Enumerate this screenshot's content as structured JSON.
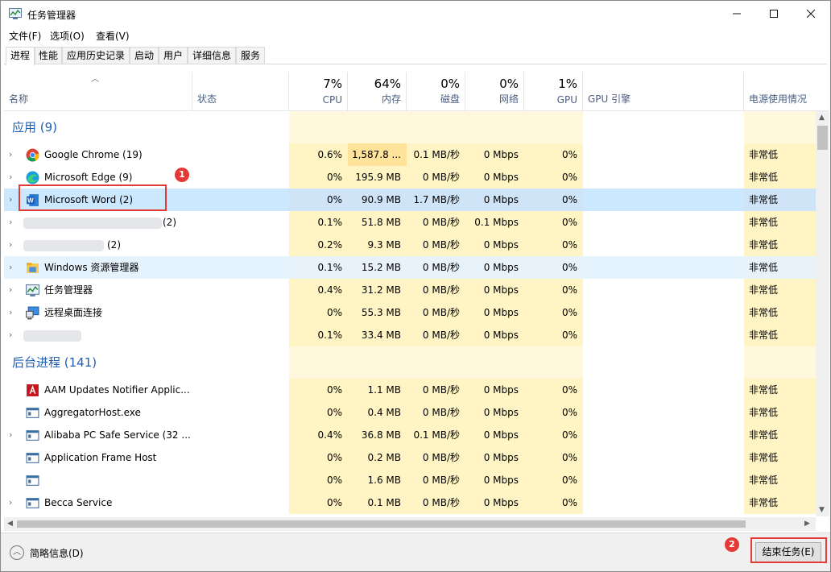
{
  "window": {
    "title": "任务管理器"
  },
  "menu": [
    "文件(F)",
    "选项(O)",
    "查看(V)"
  ],
  "tabs": [
    "进程",
    "性能",
    "应用历史记录",
    "启动",
    "用户",
    "详细信息",
    "服务"
  ],
  "columns": {
    "name": "名称",
    "status": "状态",
    "cpu": {
      "pct": "7%",
      "label": "CPU"
    },
    "mem": {
      "pct": "64%",
      "label": "内存"
    },
    "disk": {
      "pct": "0%",
      "label": "磁盘"
    },
    "net": {
      "pct": "0%",
      "label": "网络"
    },
    "gpu": {
      "pct": "1%",
      "label": "GPU"
    },
    "gpu_engine": "GPU 引擎",
    "power": "电源使用情况"
  },
  "groups": {
    "apps": "应用 (9)",
    "background": "后台进程 (141)"
  },
  "apps": [
    {
      "name": "Google Chrome (19)",
      "icon": "chrome-icon",
      "cpu": "0.6%",
      "mem": "1,587.8 ...",
      "disk": "0.1 MB/秒",
      "net": "0 Mbps",
      "gpu": "0%",
      "power": "非常低"
    },
    {
      "name": "Microsoft Edge (9)",
      "icon": "edge-icon",
      "cpu": "0%",
      "mem": "195.9 MB",
      "disk": "0 MB/秒",
      "net": "0 Mbps",
      "gpu": "0%",
      "power": "非常低"
    },
    {
      "name": "Microsoft Word (2)",
      "icon": "word-icon",
      "cpu": "0%",
      "mem": "90.9 MB",
      "disk": "1.7 MB/秒",
      "net": "0 Mbps",
      "gpu": "0%",
      "power": "非常低"
    },
    {
      "name": "(2)",
      "icon": "blurred-icon",
      "cpu": "0.1%",
      "mem": "51.8 MB",
      "disk": "0 MB/秒",
      "net": "0.1 Mbps",
      "gpu": "0%",
      "power": "非常低"
    },
    {
      "name": "(2)",
      "icon": "blurred-icon",
      "cpu": "0.2%",
      "mem": "9.3 MB",
      "disk": "0 MB/秒",
      "net": "0 Mbps",
      "gpu": "0%",
      "power": "非常低"
    },
    {
      "name": "Windows 资源管理器",
      "icon": "folder-icon",
      "cpu": "0.1%",
      "mem": "15.2 MB",
      "disk": "0 MB/秒",
      "net": "0 Mbps",
      "gpu": "0%",
      "power": "非常低"
    },
    {
      "name": "任务管理器",
      "icon": "task-manager-icon",
      "cpu": "0.4%",
      "mem": "31.2 MB",
      "disk": "0 MB/秒",
      "net": "0 Mbps",
      "gpu": "0%",
      "power": "非常低"
    },
    {
      "name": "远程桌面连接",
      "icon": "remote-desktop-icon",
      "cpu": "0%",
      "mem": "55.3 MB",
      "disk": "0 MB/秒",
      "net": "0 Mbps",
      "gpu": "0%",
      "power": "非常低"
    },
    {
      "name": "",
      "icon": "blurred-icon",
      "cpu": "0.1%",
      "mem": "33.4 MB",
      "disk": "0 MB/秒",
      "net": "0 Mbps",
      "gpu": "0%",
      "power": "非常低"
    }
  ],
  "background": [
    {
      "name": "AAM Updates Notifier Applic...",
      "icon": "adobe-icon",
      "cpu": "0%",
      "mem": "1.1 MB",
      "disk": "0 MB/秒",
      "net": "0 Mbps",
      "gpu": "0%",
      "power": "非常低"
    },
    {
      "name": "AggregatorHost.exe",
      "icon": "window-icon",
      "cpu": "0%",
      "mem": "0.4 MB",
      "disk": "0 MB/秒",
      "net": "0 Mbps",
      "gpu": "0%",
      "power": "非常低"
    },
    {
      "name": "Alibaba PC Safe Service (32 ...",
      "icon": "window-icon",
      "cpu": "0.4%",
      "mem": "36.8 MB",
      "disk": "0.1 MB/秒",
      "net": "0 Mbps",
      "gpu": "0%",
      "power": "非常低"
    },
    {
      "name": "Application Frame Host",
      "icon": "window-icon",
      "cpu": "0%",
      "mem": "0.2 MB",
      "disk": "0 MB/秒",
      "net": "0 Mbps",
      "gpu": "0%",
      "power": "非常低"
    },
    {
      "name": "",
      "icon": "window-icon",
      "cpu": "0%",
      "mem": "1.6 MB",
      "disk": "0 MB/秒",
      "net": "0 Mbps",
      "gpu": "0%",
      "power": "非常低"
    },
    {
      "name": "Becca Service",
      "icon": "window-icon",
      "cpu": "0%",
      "mem": "0.1 MB",
      "disk": "0 MB/秒",
      "net": "0 Mbps",
      "gpu": "0%",
      "power": "非常低"
    }
  ],
  "footer": {
    "fewer_details": "简略信息(D)",
    "end_task": "结束任务(E)"
  },
  "annotations": {
    "badge1": "1",
    "badge2": "2",
    "color": "#e53935"
  }
}
